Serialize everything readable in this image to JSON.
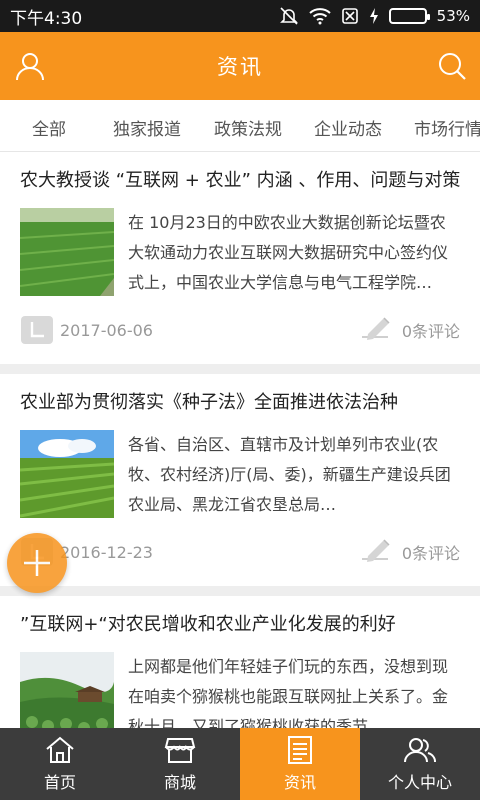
{
  "status_bar": {
    "time": "下午4:30",
    "battery": "53%",
    "battery_level": 0.53
  },
  "header": {
    "title": "资讯"
  },
  "tabs": [
    {
      "label": "全部"
    },
    {
      "label": "独家报道"
    },
    {
      "label": "政策法规"
    },
    {
      "label": "企业动态"
    },
    {
      "label": "市场行情"
    }
  ],
  "articles": [
    {
      "title": "农大教授谈 “互联网 + 农业” 内涵 、作用、问题与对策",
      "summary": "在 10月23日的中欧农业大数据创新论坛暨农大软通动力农业互联网大数据研究中心签约仪式上，中国农业大学信息与电气工程学院…",
      "date": "2017-06-06",
      "comments": "0条评论"
    },
    {
      "title": "农业部为贯彻落实《种子法》全面推进依法治种",
      "summary": "各省、自治区、直辖市及计划单列市农业(农牧、农村经济)厅(局、委)，新疆生产建设兵团农业局、黑龙江省农垦总局…",
      "date": "2016-12-23",
      "comments": "0条评论"
    },
    {
      "title": "”互联网+“对农民增收和农业产业化发展的利好",
      "summary": "上网都是他们年轻娃子们玩的东西，没想到现在咱卖个猕猴桃也能跟互联网扯上关系了。金秋十月，又到了猕猴桃收获的季节…",
      "date": "",
      "comments": ""
    }
  ],
  "bottom_nav": [
    {
      "label": "首页",
      "icon": "home-icon"
    },
    {
      "label": "商城",
      "icon": "store-icon"
    },
    {
      "label": "资讯",
      "icon": "news-icon",
      "active": true
    },
    {
      "label": "个人中心",
      "icon": "people-icon"
    }
  ],
  "colors": {
    "accent": "#f7941d",
    "nav_bg": "#3c3c3c",
    "status_bg": "#1a1a1a"
  }
}
